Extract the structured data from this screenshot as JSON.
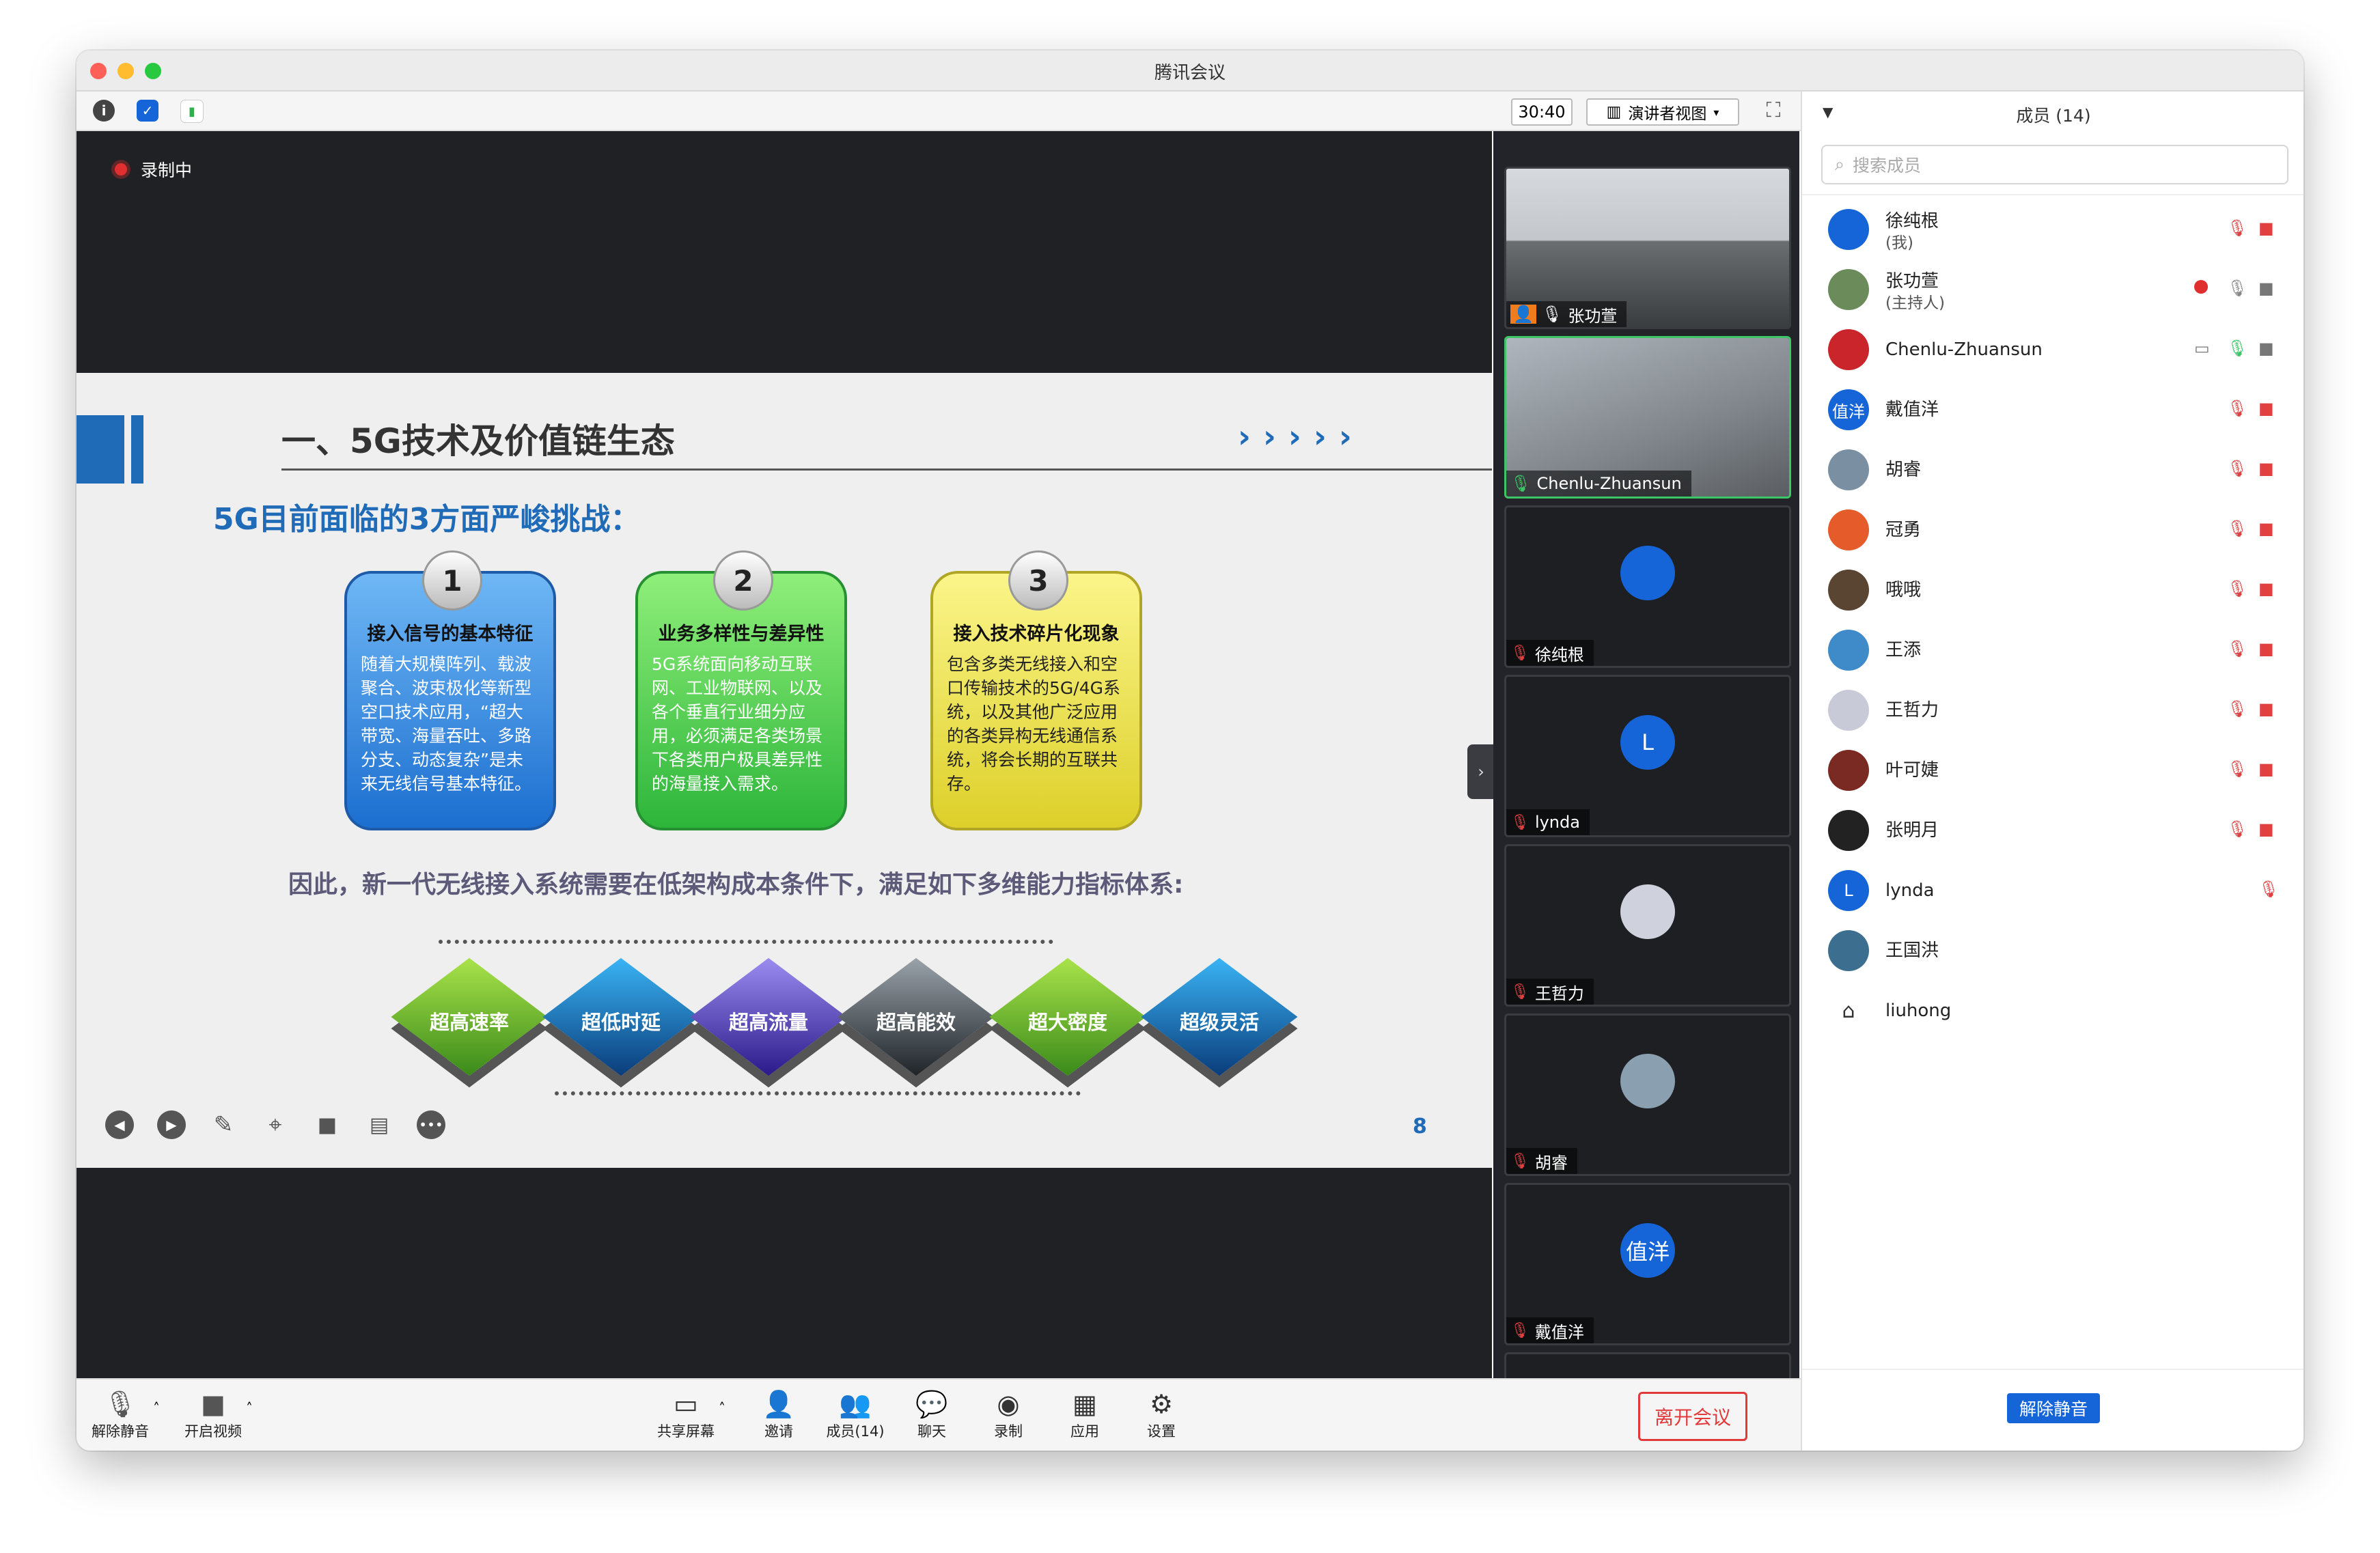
{
  "window": {
    "title": "腾讯会议"
  },
  "toolbar": {
    "timer": "30:40",
    "view_label": "演讲者视图"
  },
  "stage": {
    "recording_label": "录制中"
  },
  "slide": {
    "title": "一、5G技术及价值链生态",
    "subtitle": "5G目前面临的3方面严峻挑战：",
    "cards": [
      {
        "num": "1",
        "title": "接入信号的基本特征",
        "body": "随着大规模阵列、载波聚合、波束极化等新型空口技术应用，“超大带宽、海量吞吐、多路分支、动态复杂”是未来无线信号基本特征。",
        "color": "#2f86df"
      },
      {
        "num": "2",
        "title": "业务多样性与差异性",
        "body": "5G系统面向移动互联网、工业物联网、以及各个垂直行业细分应用，必须满足各类场景下各类用户极具差异性的海量接入需求。",
        "color": "#36c23f"
      },
      {
        "num": "3",
        "title": "接入技术碎片化现象",
        "body": "包含多类无线接入和空口传输技术的5G/4G系统，以及其他广泛应用的各类异构无线通信系统，将会长期的互联共存。",
        "color": "#e6df35"
      }
    ],
    "conclusion": "因此，新一代无线接入系统需要在低架构成本条件下，满足如下多维能力指标体系:",
    "capabilities": [
      "超高速率",
      "超低时延",
      "超高流量",
      "超高能效",
      "超大密度",
      "超级灵活"
    ],
    "page_number": "8"
  },
  "video_tiles": [
    {
      "name": "张功萱",
      "type": "camera"
    },
    {
      "name": "Chenlu-Zhuansun",
      "type": "camera"
    },
    {
      "name": "徐纯根",
      "avatar_text": "",
      "avatar_color": "#1565d8"
    },
    {
      "name": "lynda",
      "avatar_text": "L",
      "avatar_color": "#1565d8"
    },
    {
      "name": "王哲力",
      "avatar_text": "",
      "avatar_color": "#cfd2dc"
    },
    {
      "name": "胡睿",
      "avatar_text": "",
      "avatar_color": "#8aa0b0"
    },
    {
      "name": "戴值洋",
      "avatar_text": "值洋",
      "avatar_color": "#1565d8"
    }
  ],
  "members_panel": {
    "title": "成员 (14)",
    "search_placeholder": "搜索成员",
    "unmute_all_label": "解除静音",
    "members": [
      {
        "name": "徐纯根",
        "sub": "(我)",
        "avatar_text": "",
        "avatar_color": "#1565d8"
      },
      {
        "name": "张功萱",
        "sub": "(主持人)",
        "avatar_text": "",
        "avatar_color": "#6b8c5a"
      },
      {
        "name": "Chenlu-Zhuansun",
        "sub": "",
        "avatar_text": "",
        "avatar_color": "#c9252b"
      },
      {
        "name": "戴值洋",
        "sub": "",
        "avatar_text": "值洋",
        "avatar_color": "#1565d8"
      },
      {
        "name": "胡睿",
        "sub": "",
        "avatar_text": "",
        "avatar_color": "#7a8fa2"
      },
      {
        "name": "冠勇",
        "sub": "",
        "avatar_text": "",
        "avatar_color": "#e55b2a"
      },
      {
        "name": "哦哦",
        "sub": "",
        "avatar_text": "",
        "avatar_color": "#5a4532"
      },
      {
        "name": "王添",
        "sub": "",
        "avatar_text": "",
        "avatar_color": "#3f8ac9"
      },
      {
        "name": "王哲力",
        "sub": "",
        "avatar_text": "",
        "avatar_color": "#c8cad8"
      },
      {
        "name": "叶可婕",
        "sub": "",
        "avatar_text": "",
        "avatar_color": "#7a2a22"
      },
      {
        "name": "张明月",
        "sub": "",
        "avatar_text": "",
        "avatar_color": "#222222"
      },
      {
        "name": "lynda",
        "sub": "",
        "avatar_text": "L",
        "avatar_color": "#1565d8"
      },
      {
        "name": "王国洪",
        "sub": "",
        "avatar_text": "",
        "avatar_color": "#3c6f8f"
      },
      {
        "name": "liuhong",
        "sub": "",
        "avatar_text": "",
        "avatar_color": "#ffffff"
      }
    ]
  },
  "bottom_bar": {
    "unmute": "解除静音",
    "start_video": "开启视频",
    "share_screen": "共享屏幕",
    "invite": "邀请",
    "members": "成员(14)",
    "chat": "聊天",
    "record": "录制",
    "apps": "应用",
    "settings": "设置",
    "leave": "离开会议"
  }
}
